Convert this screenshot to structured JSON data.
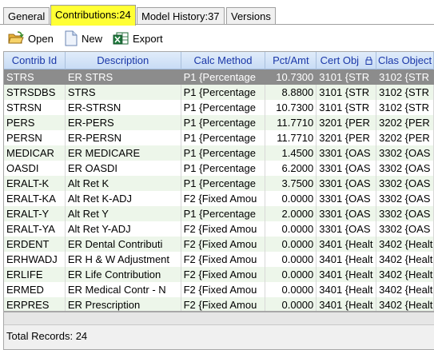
{
  "tabs": [
    {
      "label": "General",
      "active": false
    },
    {
      "label": "Contributions:24",
      "active": true
    },
    {
      "label": "Model History:37",
      "active": false
    },
    {
      "label": "Versions",
      "active": false
    }
  ],
  "toolbar": {
    "open_label": "Open",
    "new_label": "New",
    "export_label": "Export"
  },
  "grid": {
    "columns": [
      "Contrib Id",
      "Description",
      "Calc Method",
      "Pct/Amt",
      "Cert Obj",
      "Clas Object"
    ],
    "rows": [
      [
        "STRS",
        "ER STRS",
        "P1 {Percentage",
        "10.7300",
        "3101 {STR",
        "3102 {STR"
      ],
      [
        "STRSDBS",
        "STRS",
        "P1 {Percentage",
        "8.8800",
        "3101 {STR",
        "3102 {STR"
      ],
      [
        "STRSN",
        "ER-STRSN",
        "P1 {Percentage",
        "10.7300",
        "3101 {STR",
        "3102 {STR"
      ],
      [
        "PERS",
        "ER-PERS",
        "P1 {Percentage",
        "11.7710",
        "3201 {PER",
        "3202 {PER"
      ],
      [
        "PERSN",
        "ER-PERSN",
        "P1 {Percentage",
        "11.7710",
        "3201 {PER",
        "3202 {PER"
      ],
      [
        "MEDICAR",
        "ER MEDICARE",
        "P1 {Percentage",
        "1.4500",
        "3301 {OAS",
        "3302 {OAS"
      ],
      [
        "OASDI",
        "ER OASDI",
        "P1 {Percentage",
        "6.2000",
        "3301 {OAS",
        "3302 {OAS"
      ],
      [
        "ERALT-K",
        "Alt Ret K",
        "P1 {Percentage",
        "3.7500",
        "3301 {OAS",
        "3302 {OAS"
      ],
      [
        "ERALT-KA",
        "Alt Ret K-ADJ",
        "F2 {Fixed Amou",
        "0.0000",
        "3301 {OAS",
        "3302 {OAS"
      ],
      [
        "ERALT-Y",
        "Alt Ret Y",
        "P1 {Percentage",
        "2.0000",
        "3301 {OAS",
        "3302 {OAS"
      ],
      [
        "ERALT-YA",
        "Alt Ret Y-ADJ",
        "F2 {Fixed Amou",
        "0.0000",
        "3301 {OAS",
        "3302 {OAS"
      ],
      [
        "ERDENT",
        "ER Dental Contributi",
        "F2 {Fixed Amou",
        "0.0000",
        "3401 {Healt",
        "3402 {Healt"
      ],
      [
        "ERHWADJ",
        "ER H & W Adjustment",
        "F2 {Fixed Amou",
        "0.0000",
        "3401 {Healt",
        "3402 {Healt"
      ],
      [
        "ERLIFE",
        "ER Life Contribution",
        "F2 {Fixed Amou",
        "0.0000",
        "3401 {Healt",
        "3402 {Healt"
      ],
      [
        "ERMED",
        "ER Medical Contr - N",
        "F2 {Fixed Amou",
        "0.0000",
        "3401 {Healt",
        "3402 {Healt"
      ],
      [
        "ERPRES",
        "ER Prescription",
        "F2 {Fixed Amou",
        "0.0000",
        "3401 {Healt",
        "3402 {Healt"
      ]
    ],
    "selected_row": 0
  },
  "status": {
    "total_label": "Total Records: 24"
  },
  "colors": {
    "active_tab": "#ffff35",
    "header_text": "#1a37a8",
    "selected_row": "#8c8c8c",
    "alt_row": "#edf6ea"
  }
}
